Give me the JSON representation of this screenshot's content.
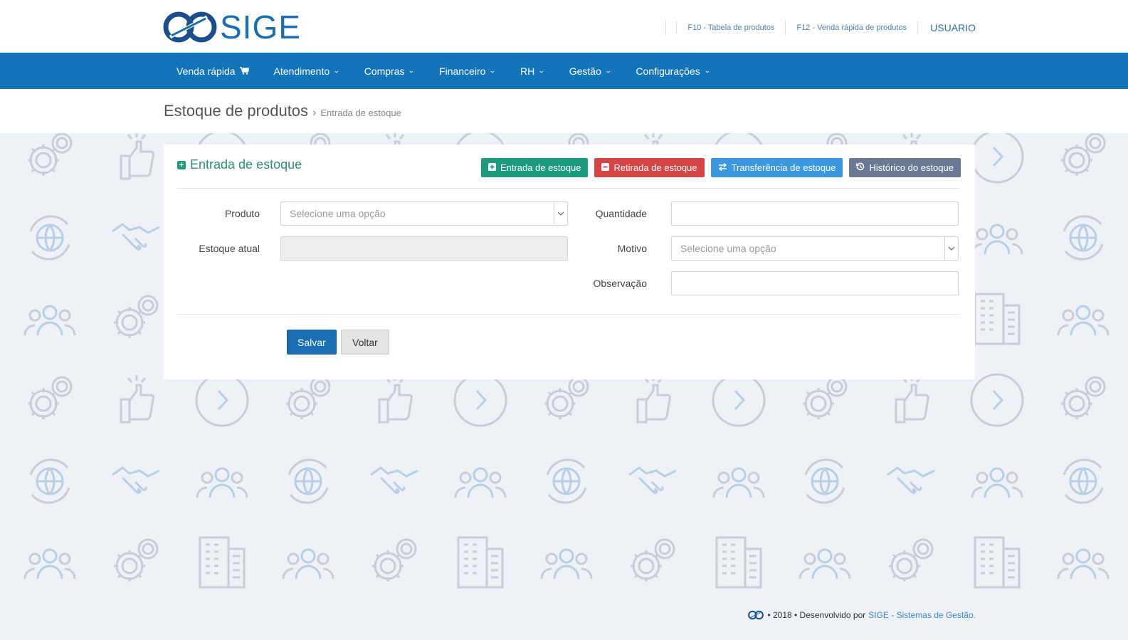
{
  "brand": {
    "name": "SIGE",
    "color": "#1a6fb4"
  },
  "top_links": {
    "f10": "F10 - Tabela de produtos",
    "f12": "F12 - Venda rápida de produtos",
    "user": "USUARIO"
  },
  "nav": {
    "items": [
      {
        "label": "Venda rápida",
        "icon": "cart-icon"
      },
      {
        "label": "Atendimento",
        "icon": "chevron-down-icon"
      },
      {
        "label": "Compras",
        "icon": "chevron-down-icon"
      },
      {
        "label": "Financeiro",
        "icon": "chevron-down-icon"
      },
      {
        "label": "RH",
        "icon": "chevron-down-icon"
      },
      {
        "label": "Gestão",
        "icon": "chevron-down-icon"
      },
      {
        "label": "Configurações",
        "icon": "chevron-down-icon"
      }
    ],
    "color": "#1374ba"
  },
  "breadcrumb": {
    "title": "Estoque de produtos",
    "separator": "›",
    "current": "Entrada de estoque"
  },
  "panel": {
    "title": "Entrada de estoque",
    "actions": {
      "entrada": "Entrada de estoque",
      "retirada": "Retirada de estoque",
      "transferencia": "Transferência de estoque",
      "historico": "Histórico do estoque"
    },
    "fields": {
      "produto": {
        "label": "Produto",
        "placeholder": "Selecione uma opção"
      },
      "estoque_atual": {
        "label": "Estoque atual",
        "value": ""
      },
      "quantidade": {
        "label": "Quantidade",
        "value": ""
      },
      "motivo": {
        "label": "Motivo",
        "placeholder": "Selecione uma opção"
      },
      "observacao": {
        "label": "Observação",
        "value": ""
      }
    },
    "save_label": "Salvar",
    "back_label": "Voltar"
  },
  "footer": {
    "text": "• 2018 • Desenvolvido por",
    "link": "SIGE - Sistemas de Gestão."
  },
  "colors": {
    "green": "#1c9c7c",
    "red": "#d64545",
    "blue": "#3c99e0",
    "grey": "#6b7a92"
  }
}
